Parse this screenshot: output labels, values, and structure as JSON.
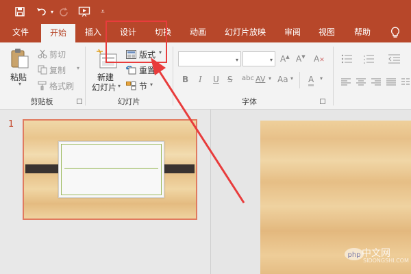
{
  "quick_access": {
    "save_icon": "save-icon",
    "undo_icon": "undo-icon",
    "redo_icon": "redo-icon",
    "present_icon": "start-from-beginning-icon",
    "customize_icon": "customize-toolbar-icon"
  },
  "tabs": [
    {
      "label": "文件"
    },
    {
      "label": "开始"
    },
    {
      "label": "插入"
    },
    {
      "label": "设计"
    },
    {
      "label": "切换"
    },
    {
      "label": "动画"
    },
    {
      "label": "幻灯片放映"
    },
    {
      "label": "审阅"
    },
    {
      "label": "视图"
    },
    {
      "label": "帮助"
    }
  ],
  "tell_me_icon": "lightbulb-icon",
  "clipboard": {
    "paste_label": "粘贴",
    "cut_label": "剪切",
    "copy_label": "复制",
    "format_painter_label": "格式刷",
    "group_label": "剪贴板"
  },
  "slides": {
    "new_slide_label_1": "新建",
    "new_slide_label_2": "幻灯片",
    "layout_label": "版式",
    "reset_label": "重置",
    "section_label": "节",
    "group_label": "幻灯片"
  },
  "font": {
    "font_name_value": "",
    "font_size_value": "",
    "bold": "B",
    "italic": "I",
    "underline": "U",
    "strikethrough": "S",
    "char_spacing": "AV",
    "change_case": "Aa",
    "clear_format": "A",
    "group_label": "字体"
  },
  "thumbnails": {
    "slide_number": "1"
  },
  "watermark": {
    "text": "中文网",
    "logo_text": "php",
    "sub_text": "SIDONGSHI.COM"
  },
  "colors": {
    "accent": "#b7472a",
    "highlight": "#e83c3c"
  }
}
